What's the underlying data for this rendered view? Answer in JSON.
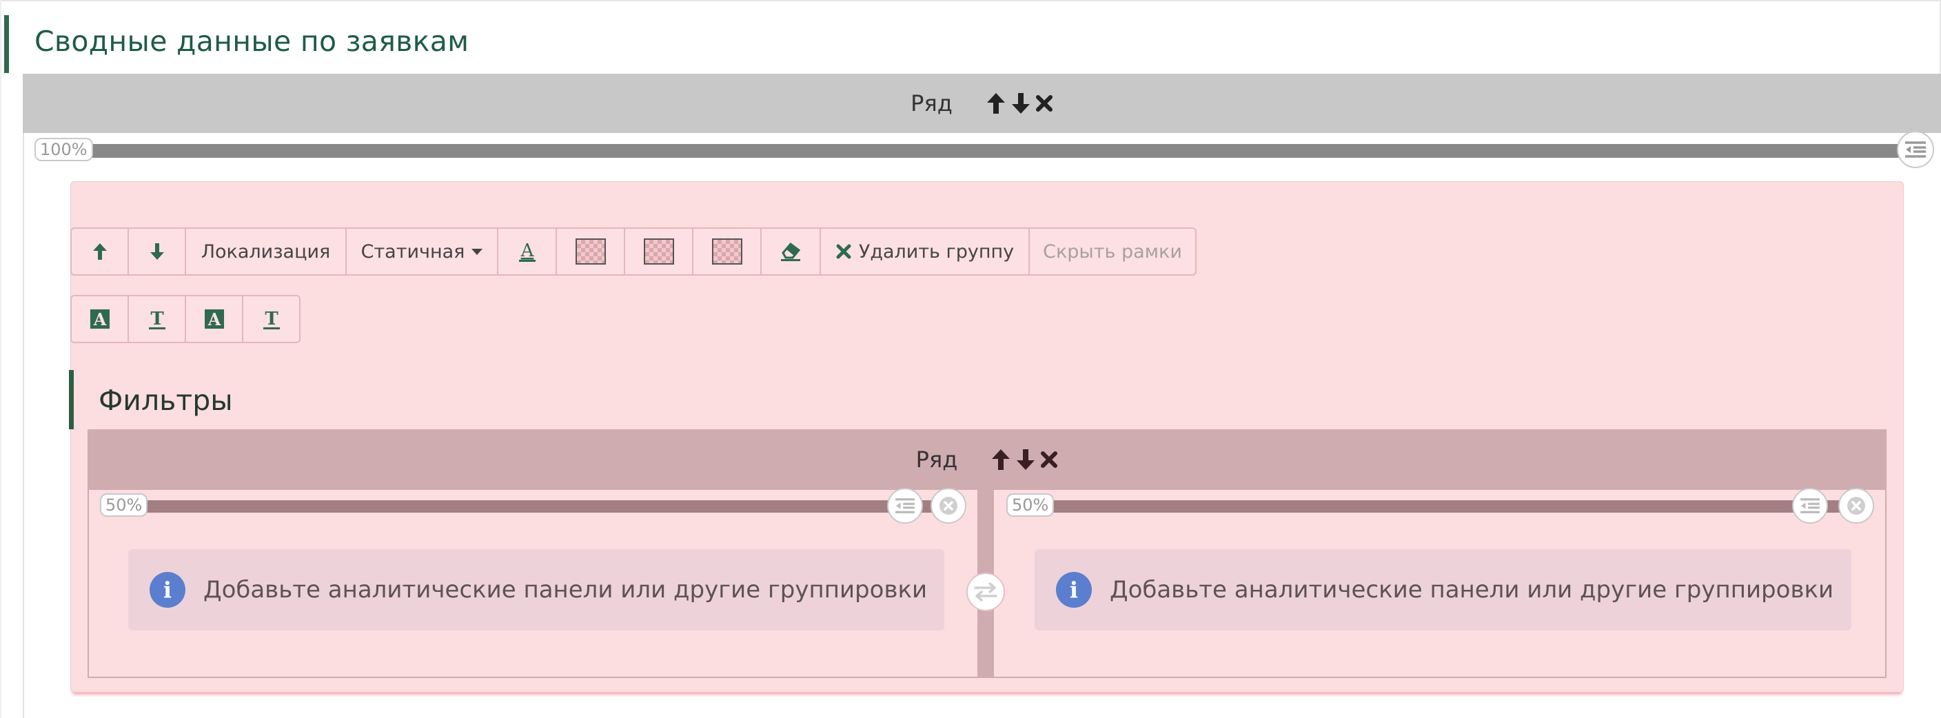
{
  "page": {
    "title": "Сводные данные по заявкам"
  },
  "outer_row": {
    "label": "Ряд",
    "width_percent": "100%"
  },
  "group": {
    "toolbar": {
      "move_up_icon": "arrow-up-icon",
      "move_down_icon": "arrow-down-icon",
      "localization_label": "Локализация",
      "mode_label": "Статичная",
      "delete_label": "Удалить группу",
      "hide_frames_label": "Скрыть рамки"
    },
    "section_title": "Фильтры",
    "inner_row": {
      "label": "Ряд",
      "columns": [
        {
          "width_percent": "50%",
          "info_text": "Добавьте аналитические панели или другие группировки"
        },
        {
          "width_percent": "50%",
          "info_text": "Добавьте аналитические панели или другие группировки"
        }
      ]
    }
  },
  "colors": {
    "accent_green": "#2d6a4f",
    "group_background": "#fcdde0",
    "inner_row_header": "#cfacaf",
    "info_icon": "#5b7fce"
  }
}
